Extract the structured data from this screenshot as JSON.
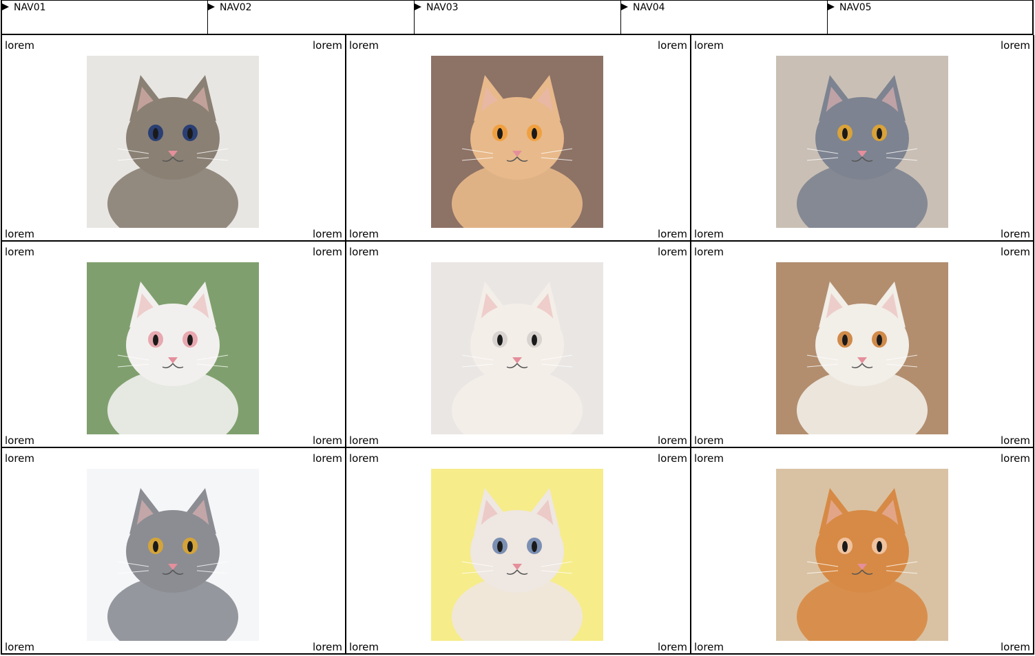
{
  "nav": {
    "items": [
      {
        "label": "NAV01"
      },
      {
        "label": "NAV02"
      },
      {
        "label": "NAV03"
      },
      {
        "label": "NAV04"
      },
      {
        "label": "NAV05"
      }
    ]
  },
  "cards": [
    {
      "tl": "lorem",
      "tr": "lorem",
      "bl": "lorem",
      "br": "lorem",
      "image": "tabby-cat-biting-sleeve-photo",
      "bg": "#e8e6e2",
      "fur": "#8a8074",
      "accent": "#2a3f73"
    },
    {
      "tl": "lorem",
      "tr": "lorem",
      "bl": "lorem",
      "br": "lorem",
      "image": "orange-cat-in-bear-hat-photo",
      "bg": "#8d7266",
      "fur": "#e8b98a",
      "accent": "#f0a040"
    },
    {
      "tl": "lorem",
      "tr": "lorem",
      "bl": "lorem",
      "br": "lorem",
      "image": "british-shorthair-cat-photo",
      "bg": "#c9bfb5",
      "fur": "#7d8390",
      "accent": "#d9a23a"
    },
    {
      "tl": "lorem",
      "tr": "lorem",
      "bl": "lorem",
      "br": "lorem",
      "image": "white-cat-green-background-photo",
      "bg": "#7fa06e",
      "fur": "#f2f0ee",
      "accent": "#e7a8b0"
    },
    {
      "tl": "lorem",
      "tr": "lorem",
      "bl": "lorem",
      "br": "lorem",
      "image": "white-kitten-in-box-photo",
      "bg": "#e9e6e4",
      "fur": "#f4eee8",
      "accent": "#d9d3d0"
    },
    {
      "tl": "lorem",
      "tr": "lorem",
      "bl": "lorem",
      "br": "lorem",
      "image": "orange-white-cat-on-floor-photo",
      "bg": "#b28e6f",
      "fur": "#f2eee8",
      "accent": "#d08a4a"
    },
    {
      "tl": "lorem",
      "tr": "lorem",
      "bl": "lorem",
      "br": "lorem",
      "image": "grey-white-cat-photo",
      "bg": "#f5f6f8",
      "fur": "#8b8d93",
      "accent": "#d4a43a"
    },
    {
      "tl": "lorem",
      "tr": "lorem",
      "bl": "lorem",
      "br": "lorem",
      "image": "kitten-yellow-background-photo",
      "bg": "#f6ec8a",
      "fur": "#efe7e1",
      "accent": "#7b8fb3"
    },
    {
      "tl": "lorem",
      "tr": "lorem",
      "bl": "lorem",
      "br": "lorem",
      "image": "ginger-cat-lying-photo",
      "bg": "#d9c2a3",
      "fur": "#d78a45",
      "accent": "#f0c3a0"
    }
  ]
}
